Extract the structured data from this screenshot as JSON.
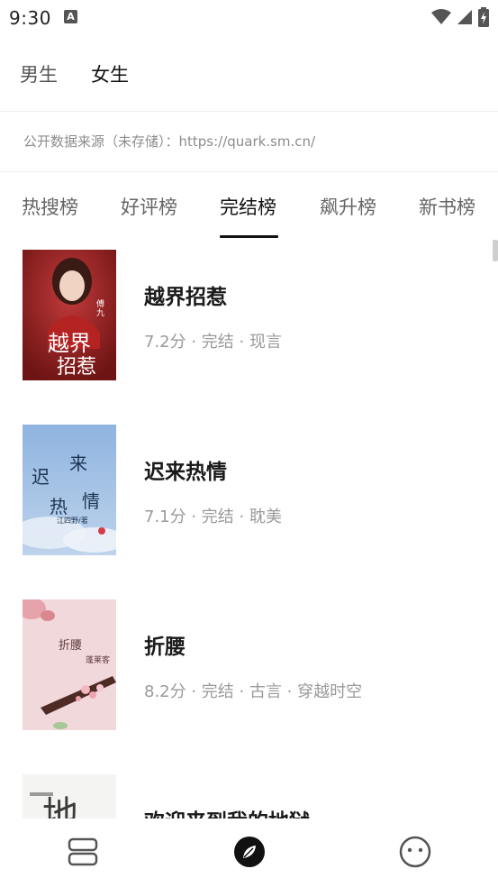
{
  "status_bar": {
    "time": "9:30",
    "notification_letter": "A"
  },
  "gender_tabs": [
    {
      "label": "男生",
      "active": false
    },
    {
      "label": "女生",
      "active": true
    }
  ],
  "source_text": "公开数据来源（未存储）：https://quark.sm.cn/",
  "rank_tabs": [
    {
      "label": "热搜榜",
      "active": false
    },
    {
      "label": "好评榜",
      "active": false
    },
    {
      "label": "完结榜",
      "active": true
    },
    {
      "label": "飙升榜",
      "active": false
    },
    {
      "label": "新书榜",
      "active": false
    }
  ],
  "books": [
    {
      "title": "越界招惹",
      "meta": "7.2分 · 完结 · 现言",
      "cover_text": "越界招惹",
      "cover_author": "傅九"
    },
    {
      "title": "迟来热情",
      "meta": "7.1分 · 完结 · 耽美",
      "cover_text": "迟来热情",
      "cover_author": "江四野/著"
    },
    {
      "title": "折腰",
      "meta": "8.2分 · 完结 · 古言 · 穿越时空",
      "cover_text": "折腰",
      "cover_author": "蓬莱客"
    },
    {
      "title": "欢迎来到我的地狱",
      "meta": "",
      "cover_text": "地",
      "cover_author": ""
    }
  ],
  "colors": {
    "accent": "#111111",
    "meta": "#9a9a9a",
    "divider": "#eeeeee"
  },
  "bottom_nav": [
    {
      "icon": "bookshelf-icon",
      "active": false
    },
    {
      "icon": "compass-icon",
      "active": true
    },
    {
      "icon": "face-icon",
      "active": false
    }
  ]
}
